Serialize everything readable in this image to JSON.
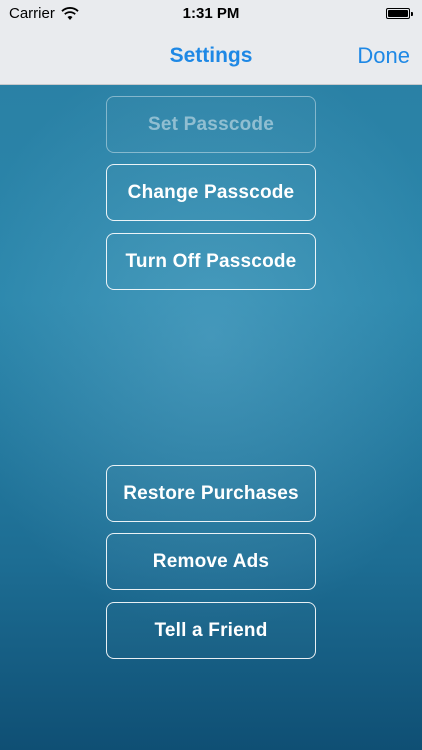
{
  "status_bar": {
    "carrier": "Carrier",
    "time": "1:31 PM",
    "wifi_icon": "wifi-icon",
    "battery_level": 1.0
  },
  "nav": {
    "title": "Settings",
    "done_label": "Done",
    "accent_color": "#1e88e5"
  },
  "buttons": {
    "set_passcode": "Set Passcode",
    "change_passcode": "Change Passcode",
    "turn_off_passcode": "Turn Off Passcode",
    "restore_purchases": "Restore Purchases",
    "remove_ads": "Remove Ads",
    "tell_a_friend": "Tell a Friend"
  }
}
